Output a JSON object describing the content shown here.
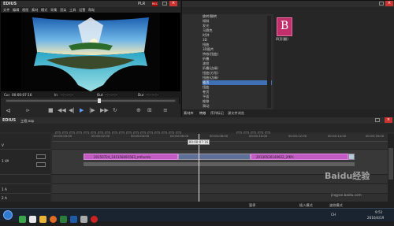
{
  "player": {
    "title": "EDIUS",
    "menu": [
      "文件",
      "编辑",
      "视图",
      "素材",
      "模式",
      "采集",
      "渲染",
      "工具",
      "设置",
      "帮助"
    ],
    "mode": "PLR",
    "rec": "REC",
    "cur_label": "Cur",
    "cur_value": "00:00:07:16",
    "in_label": "In",
    "in_value": "--:--:--:--",
    "out_label": "Out",
    "out_value": "--:--:--:--",
    "dur_label": "Dur",
    "dur_value": "--:--:--:--"
  },
  "bin": {
    "tree": [
      "旋转/翻转",
      "倾斜",
      "发光",
      "马赛克",
      "时钟",
      "3D",
      "扭曲",
      "3D图片",
      "特效(扭曲)",
      "折叠",
      "波纹",
      "折叠(边缘)",
      "扭曲(方形)",
      "扭曲(边缘)",
      "旋转",
      "扭曲",
      "卷页",
      "平面",
      "推移",
      "滑动",
      "溶化",
      "手动擦除",
      "滑动",
      "插页",
      "激光",
      "扭曲",
      "扭曲(方形)"
    ],
    "selected": "插页",
    "item_label": "四页(翻)",
    "tabs": [
      "素材库",
      "特效",
      "序列标记",
      "源文件浏览"
    ]
  },
  "timeline": {
    "title": "EDIUS",
    "project": "工程.ezp",
    "playhead_tc": "00:00:07:16",
    "ticks": [
      "00:00:00:00",
      "00:00:02:00",
      "00:00:04:00",
      "00:00:06:00",
      "00:00:08:00",
      "00:00:10:00",
      "00:00:12:00",
      "00:00:14:00",
      "00:00:16:00"
    ],
    "tracks": [
      "V",
      "1 VA",
      "",
      "1 A",
      "2 A"
    ],
    "clip_a": "20150724_141158491563_mthumb",
    "clip_b": "20130526140622_2fKfs",
    "status_left": "暂停",
    "status_mid": "插入模式",
    "status_right": "波纹模式",
    "accent": "#c040c0"
  },
  "taskbar": {
    "time": "9:51",
    "date": "2016/4/19",
    "watermark": "Baidu经验",
    "watermark_url": "jingyan.baidu.com",
    "lang": "CH"
  }
}
